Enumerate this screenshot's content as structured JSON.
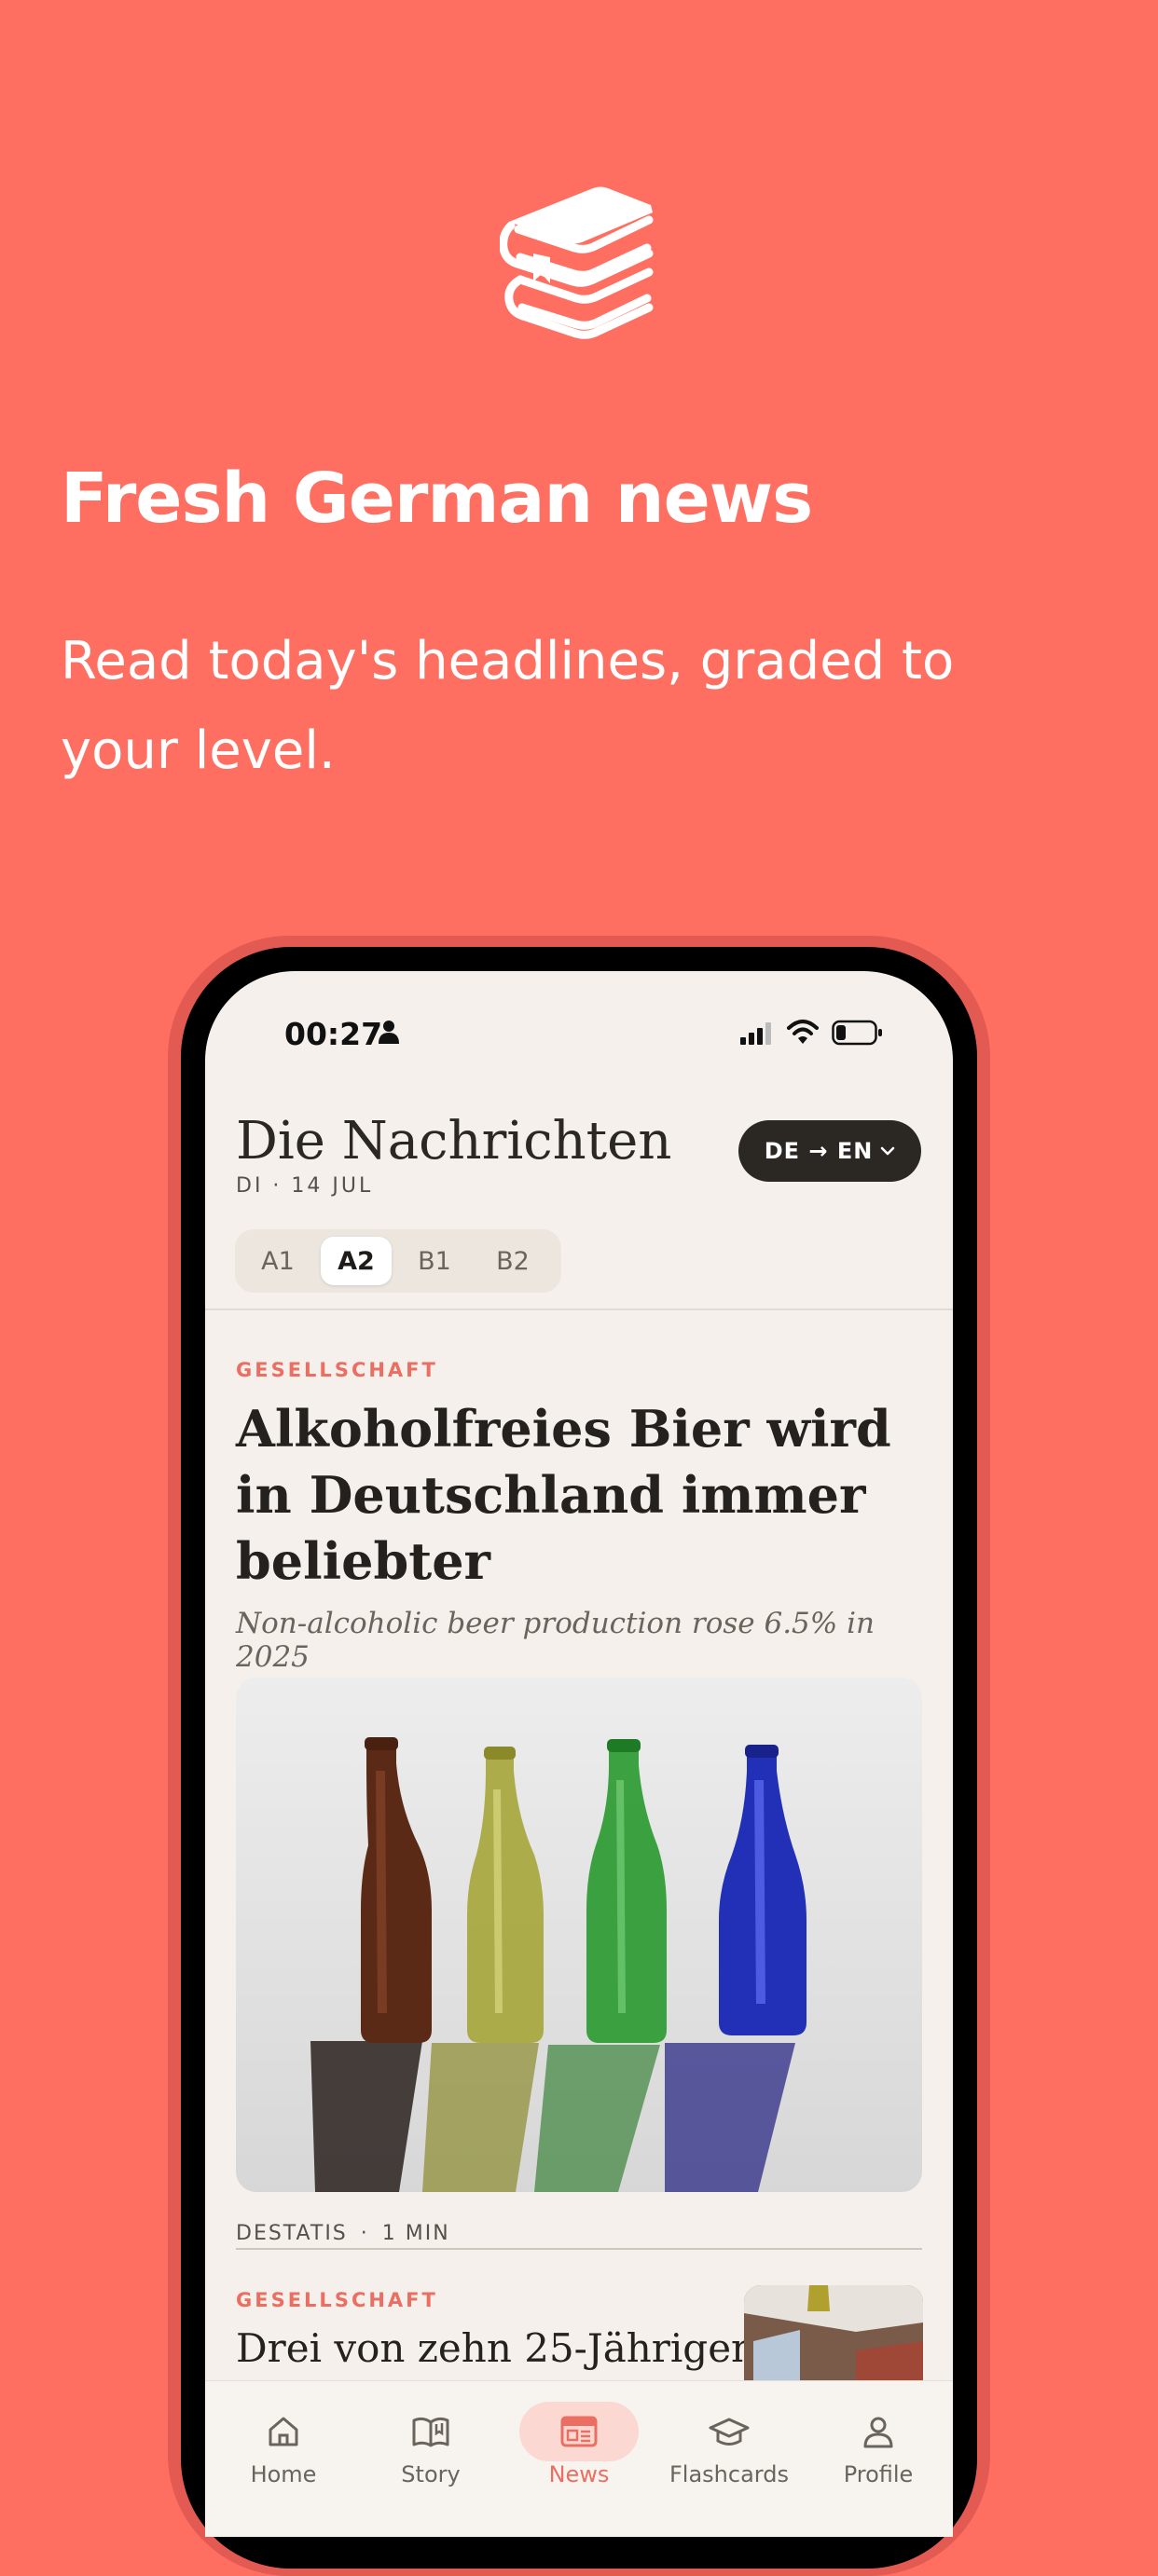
{
  "promo": {
    "title": "Fresh German news",
    "subtitle": "Read today's headlines, graded to your level."
  },
  "status_bar": {
    "time": "00:27"
  },
  "header": {
    "title": "Die Nachrichten",
    "date": "DI · 14 JUL",
    "language_toggle": "DE → EN"
  },
  "levels": {
    "items": [
      "A1",
      "A2",
      "B1",
      "B2"
    ],
    "selected": "A2"
  },
  "article": {
    "category": "GESELLSCHAFT",
    "headline": "Alkoholfreies Bier wird in Deutschland immer beliebter",
    "translation": "Non-alcoholic beer production rose 6.5% in 2025",
    "source": "DESTATIS",
    "separator": "·",
    "read_time": "1 MIN"
  },
  "article2": {
    "category": "GESELLSCHAFT",
    "headline": "Drei von zehn 25-Jährigen"
  },
  "tabs": [
    {
      "label": "Home",
      "icon": "home-icon"
    },
    {
      "label": "Story",
      "icon": "open-book-icon"
    },
    {
      "label": "News",
      "icon": "newspaper-icon"
    },
    {
      "label": "Flashcards",
      "icon": "graduation-cap-icon"
    },
    {
      "label": "Profile",
      "icon": "person-icon"
    }
  ],
  "active_tab": "News",
  "colors": {
    "background": "#ff6f61",
    "accent": "#ea6f62",
    "screen": "#f5f0eb",
    "ink": "#2b2723"
  }
}
